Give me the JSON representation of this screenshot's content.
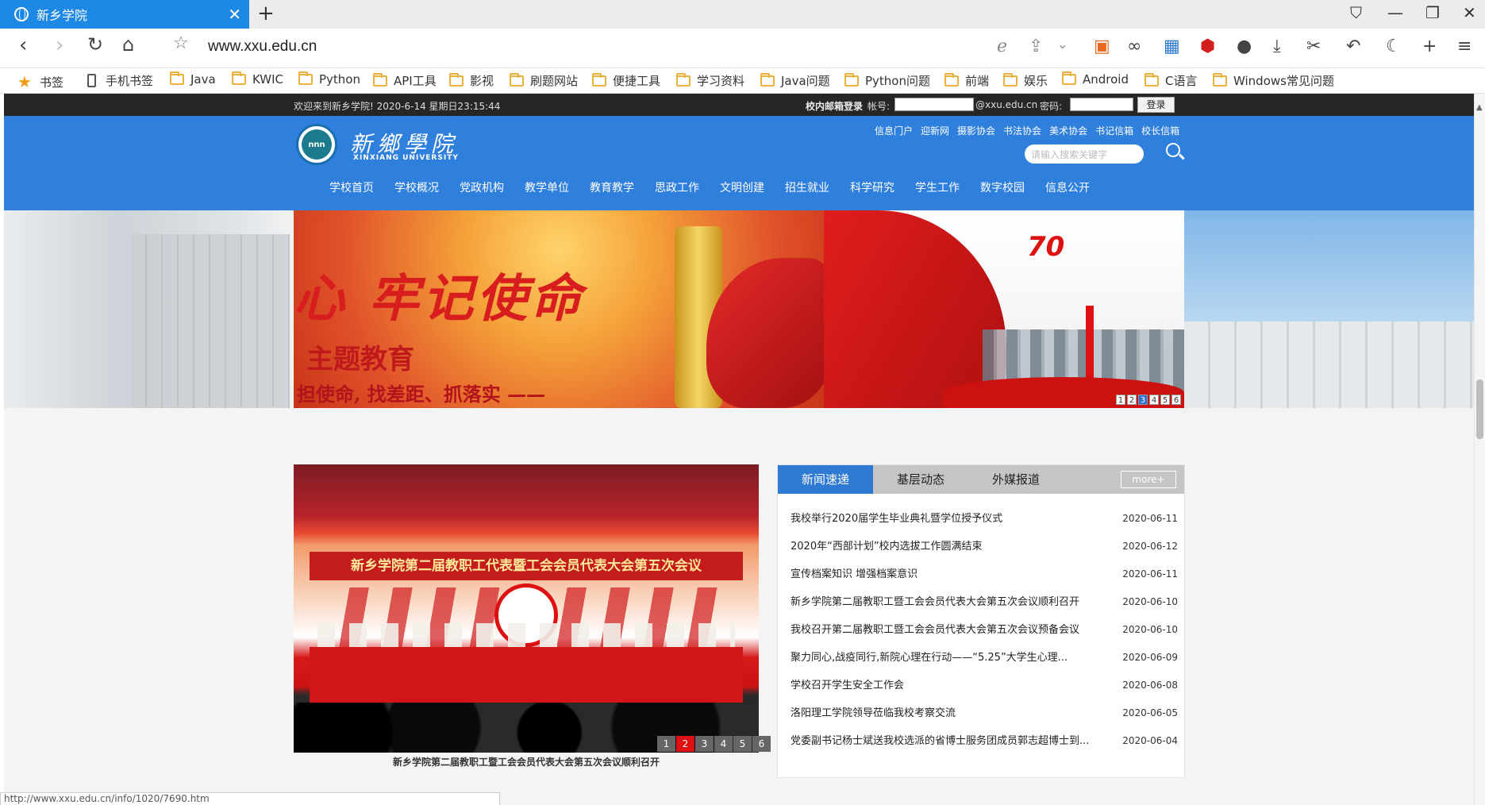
{
  "browser": {
    "tab_title": "新乡学院",
    "url": "www.xxu.edu.cn",
    "status_url": "http://www.xxu.edu.cn/info/1020/7690.htm",
    "bookmarks_label": "书签",
    "bookmarks": [
      "手机书签",
      "Java",
      "KWIC",
      "Python",
      "API工具",
      "影视",
      "刷题网站",
      "便捷工具",
      "学习资料",
      "Java问题",
      "Python问题",
      "前端",
      "娱乐",
      "Android",
      "C语言",
      "Windows常见问题"
    ]
  },
  "topbar": {
    "welcome": "欢迎来到新乡学院!  2020-6-14 星期日23:15:44",
    "mail_label": "校内邮箱登录",
    "account_label": "帐号:",
    "domain": "@xxu.edu.cn",
    "password_label": "密码:",
    "login_button": "登录"
  },
  "header": {
    "brand_cn": "新鄉學院",
    "brand_en": "XINXIANG UNIVERSITY",
    "logo_text": "nnn",
    "top_links": [
      "信息门户",
      "迎新网",
      "摄影协会",
      "书法协会",
      "美术协会",
      "书记信箱",
      "校长信箱"
    ],
    "search_placeholder": "请输入搜索关键字",
    "nav": [
      "学校首页",
      "学校概况",
      "党政机构",
      "教学单位",
      "教育教学",
      "思政工作",
      "文明创建",
      "招生就业",
      "科学研究",
      "学生工作",
      "数字校园",
      "信息公开"
    ]
  },
  "banner": {
    "slide_line1": "心 牢记使命",
    "slide_line2": "主题教育",
    "slide_line3": "担使命, 找差距、抓落实 ——",
    "badge": "70",
    "pager": [
      "1",
      "2",
      "3",
      "4",
      "5",
      "6"
    ],
    "active_index": 2
  },
  "photo_news": {
    "banner_text": "新乡学院第二届教职工代表暨工会会员代表大会第五次会议",
    "caption": "新乡学院第二届教职工暨工会会员代表大会第五次会议顺利召开",
    "pager": [
      "1",
      "2",
      "3",
      "4",
      "5",
      "6"
    ],
    "active_index": 1
  },
  "news": {
    "tabs": [
      "新闻速递",
      "基层动态",
      "外媒报道"
    ],
    "more": "more+",
    "items": [
      {
        "title": "我校举行2020届学生毕业典礼暨学位授予仪式",
        "date": "2020-06-11"
      },
      {
        "title": "2020年“西部计划”校内选拔工作圆满结束",
        "date": "2020-06-12"
      },
      {
        "title": "宣传档案知识 增强档案意识",
        "date": "2020-06-11"
      },
      {
        "title": "新乡学院第二届教职工暨工会会员代表大会第五次会议顺利召开",
        "date": "2020-06-10"
      },
      {
        "title": "我校召开第二届教职工暨工会会员代表大会第五次会议预备会议",
        "date": "2020-06-10"
      },
      {
        "title": "聚力同心,战疫同行,新院心理在行动——“5.25”大学生心理...",
        "date": "2020-06-09"
      },
      {
        "title": "学校召开学生安全工作会",
        "date": "2020-06-08"
      },
      {
        "title": "洛阳理工学院领导莅临我校考察交流",
        "date": "2020-06-05"
      },
      {
        "title": "党委副书记杨士斌送我校选派的省博士服务团成员郭志超博士到...",
        "date": "2020-06-04"
      }
    ]
  }
}
